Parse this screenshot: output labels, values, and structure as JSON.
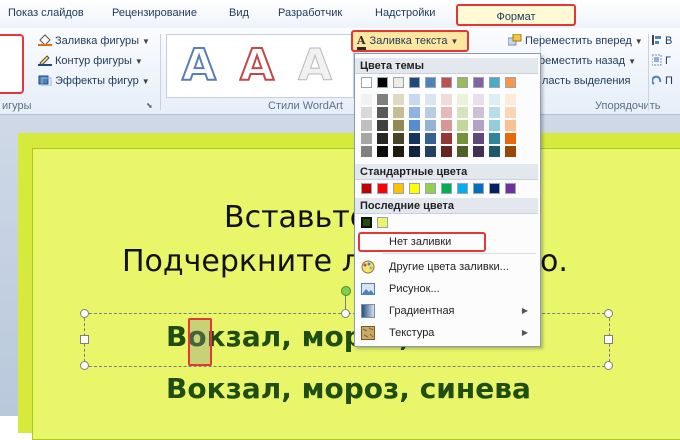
{
  "tabs": [
    "Показ слайдов",
    "Рецензирование",
    "Вид",
    "Разработчик",
    "Надстройки",
    "Формат"
  ],
  "ribbon": {
    "shape_fill": "Заливка фигуры",
    "shape_outline": "Контур фигуры",
    "shape_effects": "Эффекты фигур",
    "group_shape_styles_partial": "игуры",
    "wordart_group": "Стили WordArt",
    "wordart_letter": "A",
    "text_fill": "Заливка текста",
    "bring_forward": "Переместить вперед",
    "send_backward": "Переместить назад",
    "selection_pane": "ласть выделения",
    "arrange_group": "Упорядочить",
    "cut_char_1": "В",
    "cut_char_2": "Г",
    "cut_char_3": "П"
  },
  "menu": {
    "theme_colors": "Цвета темы",
    "standard_colors": "Стандартные цвета",
    "recent_colors": "Последние цвета",
    "no_fill": "Нет заливки",
    "more_colors": "Другие цвета заливки...",
    "picture": "Рисунок...",
    "gradient": "Градиентная",
    "texture": "Текстура",
    "theme_top_row": [
      "#ffffff",
      "#000000",
      "#eeece1",
      "#1f497d",
      "#4f81bd",
      "#c0504d",
      "#9bbb59",
      "#8064a2",
      "#4bacc6",
      "#f79646"
    ],
    "theme_columns": [
      [
        "#f2f2f2",
        "#d9d9d9",
        "#bfbfbf",
        "#a6a6a6",
        "#808080"
      ],
      [
        "#7f7f7f",
        "#595959",
        "#3f3f3f",
        "#262626",
        "#0d0d0d"
      ],
      [
        "#ddd9c3",
        "#c4bd97",
        "#938953",
        "#494429",
        "#1d1b10"
      ],
      [
        "#c6d9f0",
        "#8db3e2",
        "#548dd4",
        "#17365d",
        "#0f243e"
      ],
      [
        "#dbe5f1",
        "#b8cce4",
        "#95b3d7",
        "#366092",
        "#244061"
      ],
      [
        "#f2dcdb",
        "#e5b9b7",
        "#d99694",
        "#953734",
        "#632423"
      ],
      [
        "#ebf1dd",
        "#d7e3bc",
        "#c3d69b",
        "#76923c",
        "#4f6128"
      ],
      [
        "#e5e0ec",
        "#ccc1d9",
        "#b2a2c7",
        "#5f497a",
        "#3f3151"
      ],
      [
        "#dbeef3",
        "#b7dde8",
        "#92cddc",
        "#31859b",
        "#205867"
      ],
      [
        "#fdeada",
        "#fbd5b5",
        "#fac08f",
        "#e36c09",
        "#974806"
      ]
    ],
    "standard": [
      "#c00000",
      "#ff0000",
      "#ffc000",
      "#ffff00",
      "#92d050",
      "#00b050",
      "#00b0f0",
      "#0070c0",
      "#002060",
      "#7030a0"
    ],
    "recent": [
      "#1f4d12",
      "#e9f66a"
    ]
  },
  "slide": {
    "line1": "Вставьте",
    "line2a": "Подчеркните л",
    "line2b": "о.",
    "word_line1": "Вокзал, мороз, синева",
    "word_line2": "Вокзал, мороз, синева"
  }
}
